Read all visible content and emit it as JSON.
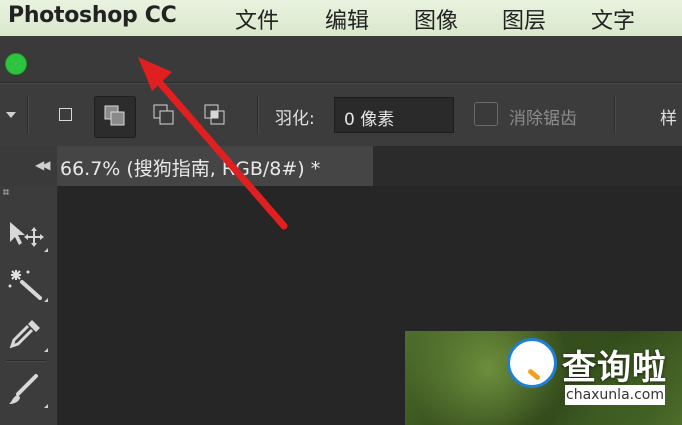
{
  "menubar": {
    "app_name": "Photoshop CC",
    "items": [
      "文件",
      "编辑",
      "图像",
      "图层",
      "文字"
    ]
  },
  "window": {
    "traffic_light_color": "#2fc43f"
  },
  "options_bar": {
    "selection_modes": [
      "new-selection",
      "add-to-selection",
      "subtract-from-selection",
      "intersect-with-selection"
    ],
    "active_mode": "add-to-selection",
    "feather_label": "羽化:",
    "feather_value": "0 像素",
    "anti_alias_label": "消除锯齿",
    "anti_alias_checked": false,
    "style_label_partial": "样"
  },
  "document_tab": {
    "title": "66.7% (搜狗指南, RGB/8#) *"
  },
  "toolbar": {
    "tools": [
      "move-tool-icon",
      "magic-wand-icon",
      "eyedropper-icon",
      "brush-icon"
    ]
  },
  "watermark": {
    "brand": "查询啦",
    "domain": "chaxunla.com",
    "badge_color": "#1f7fd6"
  },
  "annotation": {
    "arrow_color": "#e02020"
  }
}
